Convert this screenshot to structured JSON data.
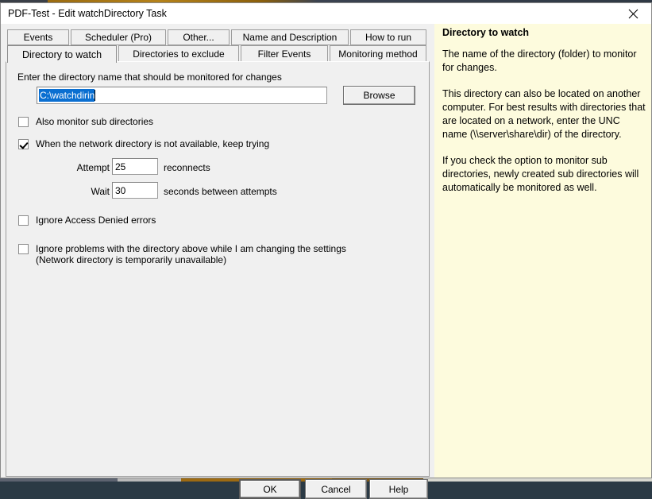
{
  "window": {
    "title": "PDF-Test - Edit watchDirectory Task",
    "close_icon": "close-icon"
  },
  "tabs": {
    "row1": [
      {
        "label": "Events",
        "selected": false
      },
      {
        "label": "Scheduler (Pro)",
        "selected": false
      },
      {
        "label": "Other...",
        "selected": false
      },
      {
        "label": "Name and Description",
        "selected": false
      },
      {
        "label": "How to run",
        "selected": false
      }
    ],
    "row2": [
      {
        "label": "Directory to watch",
        "selected": true
      },
      {
        "label": "Directories to exclude",
        "selected": false
      },
      {
        "label": "Filter Events",
        "selected": false
      },
      {
        "label": "Monitoring method",
        "selected": false
      }
    ]
  },
  "form": {
    "directory_instruction": "Enter the directory name that should be monitored for changes",
    "directory_value": "C:\\watchdirin",
    "directory_selected": true,
    "browse_label": "Browse",
    "checkbox_subdirs": {
      "label": "Also monitor sub directories",
      "checked": false
    },
    "checkbox_keep_trying": {
      "label": "When the network directory is not available, keep trying",
      "checked": true
    },
    "attempt_label": "Attempt",
    "attempt_value": "25",
    "attempt_unit": "reconnects",
    "wait_label": "Wait",
    "wait_value": "30",
    "wait_unit": "seconds between attempts",
    "checkbox_ignore_access": {
      "label": "Ignore Access Denied errors",
      "checked": false
    },
    "checkbox_ignore_problems": {
      "label": "Ignore problems with the directory above while I am changing the settings\n(Network directory is temporarily unavailable)",
      "checked": false
    }
  },
  "buttons": {
    "ok": "OK",
    "cancel": "Cancel",
    "help": "Help"
  },
  "help": {
    "title": "Directory to watch",
    "paragraph1": "The name of the directory (folder) to monitor for changes.",
    "paragraph2": "This directory can also be located on another computer. For best results with directories that are located on a network, enter the UNC name (\\\\server\\share\\dir) of the directory.",
    "paragraph3": "If you check the option to monitor sub directories, newly created sub directories will automatically be monitored as well."
  },
  "colors": {
    "help_background": "#fdfbdd",
    "dialog_background": "#f0f0f0",
    "selection_blue": "#0a6fd1"
  }
}
